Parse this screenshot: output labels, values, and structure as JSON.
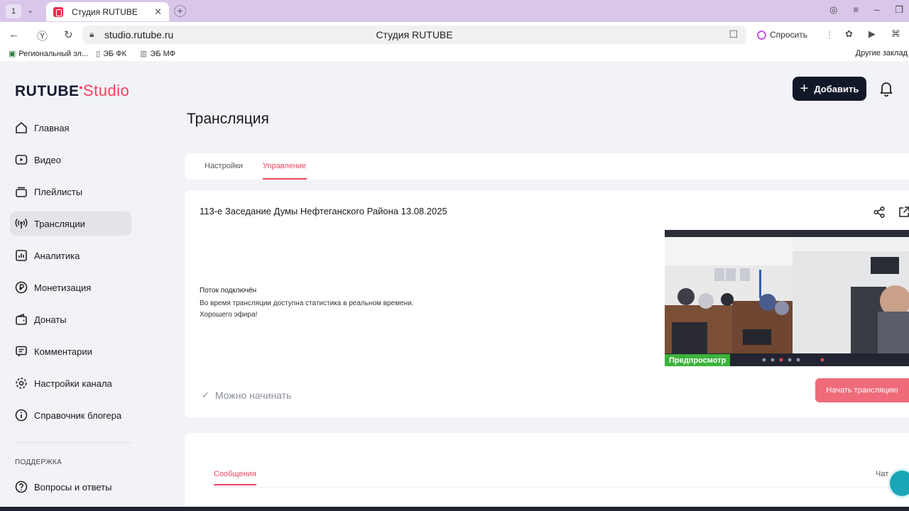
{
  "browser": {
    "tab_count": "1",
    "tab_title": "Студия RUTUBE",
    "url": "studio.rutube.ru",
    "page_title": "Студия RUTUBE",
    "ask_label": "Спросить",
    "bookmarks": [
      "Региональный эл...",
      "ЭБ ФК",
      "ЭБ МФ"
    ],
    "other_bookmarks": "Другие заклад"
  },
  "header": {
    "logo_main": "RUTUBE",
    "logo_studio": "Studio",
    "add_label": "Добавить"
  },
  "sidebar": {
    "items": [
      {
        "label": "Главная",
        "icon": "home-icon"
      },
      {
        "label": "Видео",
        "icon": "video-icon"
      },
      {
        "label": "Плейлисты",
        "icon": "playlist-icon"
      },
      {
        "label": "Трансляции",
        "icon": "broadcast-icon",
        "active": true
      },
      {
        "label": "Аналитика",
        "icon": "analytics-icon"
      },
      {
        "label": "Монетизация",
        "icon": "ruble-icon"
      },
      {
        "label": "Донаты",
        "icon": "wallet-icon"
      },
      {
        "label": "Комментарии",
        "icon": "comment-icon"
      },
      {
        "label": "Настройки канала",
        "icon": "gear-icon"
      },
      {
        "label": "Справочник блогера",
        "icon": "info-icon"
      }
    ],
    "support_label": "ПОДДЕРЖКА",
    "support_items": [
      {
        "label": "Вопросы и ответы",
        "icon": "question-icon"
      }
    ]
  },
  "main": {
    "title": "Трансляция",
    "tabs": [
      {
        "label": "Настройки",
        "active": false
      },
      {
        "label": "Управление",
        "active": true
      }
    ],
    "stream": {
      "title": "113-е Заседание Думы Нефтеганского Района 13.08.2025",
      "status_heading": "Поток подключён",
      "status_line1": "Во время трансляции доступна статистика в реальном времени.",
      "status_line2": "Хорошего эфира!",
      "ready_label": "Можно начинать",
      "start_label": "Начать трансляцию",
      "preview_badge": "Предпросмотр"
    },
    "messages": {
      "tab_label": "Сообщения",
      "chat_label": "Чат"
    }
  },
  "colors": {
    "accent": "#e8485f",
    "primary_button": "#111827",
    "start_button": "#ef6b7a",
    "preview_badge": "#3cb33c"
  }
}
